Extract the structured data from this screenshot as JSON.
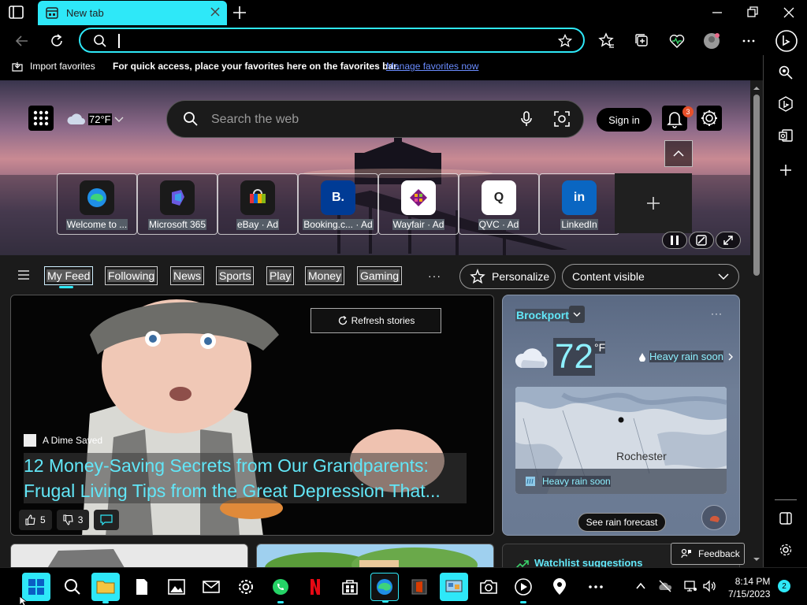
{
  "browser": {
    "tab_title": "New tab",
    "address_value": "",
    "favorites_bar": {
      "import_label": "Import favorites",
      "message": "For quick access, place your favorites here on the favorites bar.",
      "link_label": "Manage favorites now"
    }
  },
  "ntp": {
    "weather_temp": "72°F",
    "search_placeholder": "Search the web",
    "sign_in_label": "Sign in",
    "notification_count": "3",
    "tiles": [
      {
        "label": "Welcome to ...",
        "icon": "edge-icon"
      },
      {
        "label": "Microsoft 365",
        "icon": "microsoft-365-icon"
      },
      {
        "label": "eBay · Ad",
        "icon": "ebay-icon"
      },
      {
        "label": "Booking.c... · Ad",
        "icon": "booking-icon",
        "glyph": "B."
      },
      {
        "label": "Wayfair · Ad",
        "icon": "wayfair-icon"
      },
      {
        "label": "QVC · Ad",
        "icon": "qvc-icon",
        "glyph": "Q"
      },
      {
        "label": "LinkedIn",
        "icon": "linkedin-icon",
        "glyph": "in"
      }
    ],
    "feed_tabs": [
      "My Feed",
      "Following",
      "News",
      "Sports",
      "Play",
      "Money",
      "Gaming"
    ],
    "more_label": "···",
    "personalize_label": "Personalize",
    "content_visible_label": "Content visible"
  },
  "story": {
    "refresh_label": "Refresh stories",
    "source": "A Dime Saved",
    "headline": "12 Money-Saving Secrets from Our Grandparents: Frugal Living Tips from the Great Depression That...",
    "likes": "5",
    "dislikes": "3"
  },
  "weather": {
    "location": "Brockport",
    "temp": "72",
    "unit": "°F",
    "alert": "Heavy rain soon",
    "map_city": "Rochester",
    "map_alert": "Heavy rain soon",
    "forecast_button": "See rain forecast"
  },
  "watchlist": {
    "title": "Watchlist suggestions"
  },
  "feedback_label": "Feedback",
  "taskbar": {
    "time": "8:14 PM",
    "date": "7/15/2023",
    "notification_count": "2"
  },
  "colors": {
    "accent": "#2ee8f8",
    "link": "#6a8cff",
    "badge": "#e8502a"
  }
}
